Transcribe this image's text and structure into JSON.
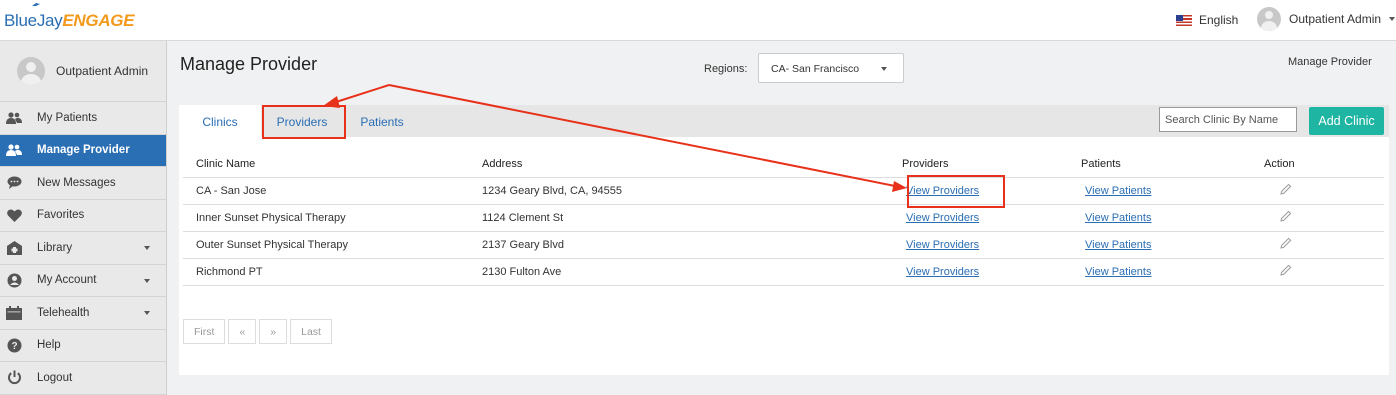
{
  "header": {
    "logo_blue": "BlueJay",
    "logo_orange": "ENGAGE",
    "language": "English",
    "user": "Outpatient Admin"
  },
  "sidebar": {
    "user": "Outpatient Admin",
    "items": [
      {
        "label": "My Patients",
        "icon": "users-icon"
      },
      {
        "label": "Manage Provider",
        "icon": "users-icon"
      },
      {
        "label": "New Messages",
        "icon": "chat-icon"
      },
      {
        "label": "Favorites",
        "icon": "heart-icon"
      },
      {
        "label": "Library",
        "icon": "library-icon"
      },
      {
        "label": "My Account",
        "icon": "account-icon"
      },
      {
        "label": "Telehealth",
        "icon": "calendar-icon"
      },
      {
        "label": "Help",
        "icon": "help-icon"
      },
      {
        "label": "Logout",
        "icon": "power-icon"
      }
    ]
  },
  "main": {
    "title": "Manage Provider",
    "regions_label": "Regions:",
    "region_value": "CA- San Francisco",
    "breadcrumb": "Manage Provider",
    "tabs": [
      "Clinics",
      "Providers",
      "Patients"
    ],
    "search_placeholder": "Search Clinic By Name",
    "add_button": "Add Clinic",
    "columns": [
      "Clinic Name",
      "Address",
      "Providers",
      "Patients",
      "Action"
    ],
    "rows": [
      {
        "name": "CA - San Jose",
        "address": "1234 Geary Blvd, CA, 94555",
        "providers": "View Providers",
        "patients": "View Patients"
      },
      {
        "name": "Inner Sunset Physical Therapy",
        "address": "1124 Clement St",
        "providers": "View Providers",
        "patients": "View Patients"
      },
      {
        "name": "Outer Sunset Physical Therapy",
        "address": "2137 Geary Blvd",
        "providers": "View Providers",
        "patients": "View Patients"
      },
      {
        "name": "Richmond PT",
        "address": "2130 Fulton Ave",
        "providers": "View Providers",
        "patients": "View Patients"
      }
    ],
    "pager": [
      "First",
      "«",
      "»",
      "Last"
    ]
  },
  "colors": {
    "brand_blue": "#2a6eb4",
    "brand_orange": "#f39a1d",
    "accent_teal": "#1fb5a3",
    "annotation_red": "#e8311a"
  }
}
